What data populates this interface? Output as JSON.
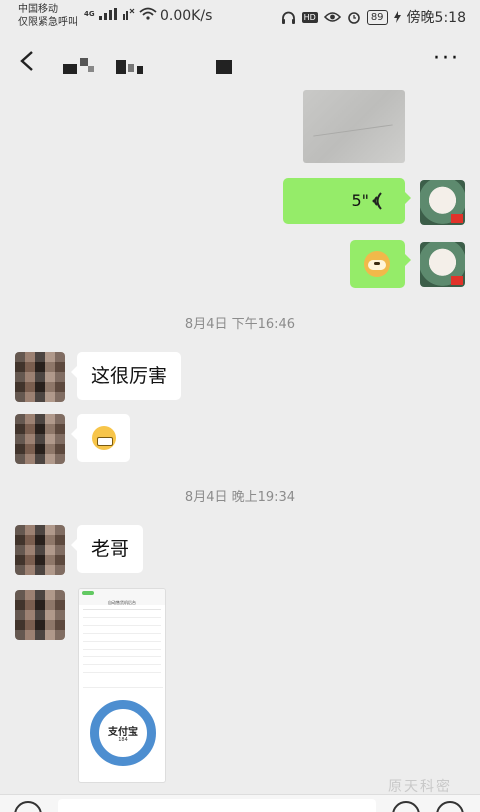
{
  "status_bar": {
    "carrier": "中国移动",
    "emergency": "仅限紧急呼叫",
    "network_label": "4G",
    "speed": "0.00K/s",
    "hd_label": "HD",
    "battery": "89",
    "time": "傍晚5:18"
  },
  "header": {
    "back_icon": "chevron-left-icon",
    "more_icon": "more-dots-icon",
    "more_label": "···"
  },
  "messages": {
    "voice_duration": "5\"",
    "voice_icon": "((",
    "timestamp_1": "8月4日 下午16:46",
    "text_1": "这很厉害",
    "timestamp_2": "8月4日 晚上19:34",
    "text_2": "老哥"
  },
  "screenshot_preview": {
    "title": "自动售货机后台",
    "ring_label": "支付宝",
    "ring_value": "184"
  },
  "watermark": "原天科密",
  "colors": {
    "bubble_green": "#95ec69",
    "background": "#ededed"
  }
}
